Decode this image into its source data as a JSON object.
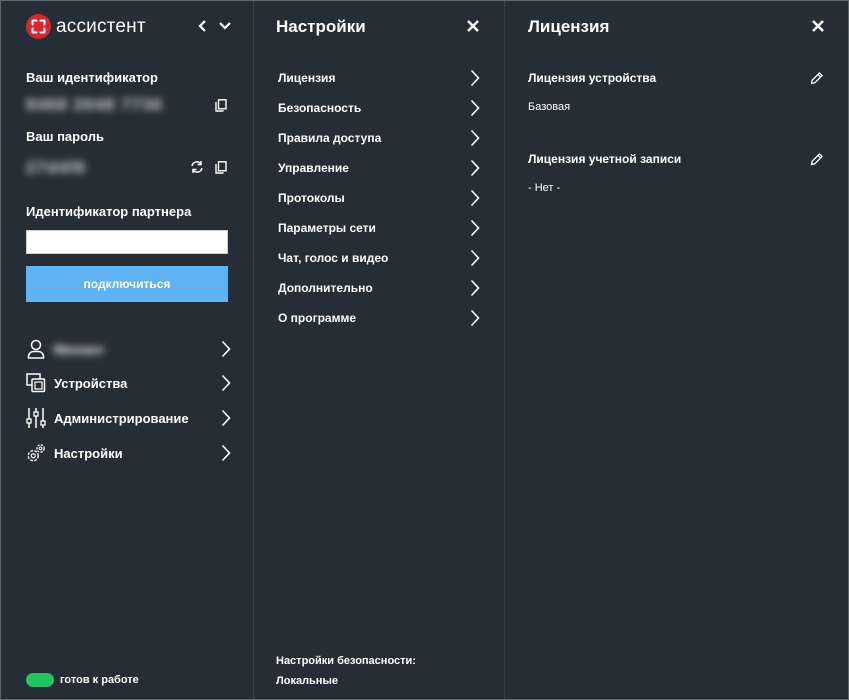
{
  "app": {
    "logo_text": "ассистент",
    "logo_color": "#d8262f"
  },
  "left": {
    "id_label": "Ваш идентификатор",
    "id_value": "8468 2648 7736",
    "password_label": "Ваш пароль",
    "password_value": "27d4f8",
    "partner_label": "Идентификатор партнера",
    "partner_value": "",
    "connect_label": "подключиться",
    "connect_color": "#5fb3f4",
    "nav": [
      {
        "label": "Михаил",
        "icon": "user-icon"
      },
      {
        "label": "Устройства",
        "icon": "devices-icon"
      },
      {
        "label": "Администрирование",
        "icon": "sliders-icon"
      },
      {
        "label": "Настройки",
        "icon": "gear-icon"
      }
    ],
    "status_text": "готов к работе",
    "status_color": "#22c55e"
  },
  "settings": {
    "title": "Настройки",
    "items": [
      "Лицензия",
      "Безопасность",
      "Правила доступа",
      "Управление",
      "Протоколы",
      "Параметры сети",
      "Чат, голос и видео",
      "Дополнительно",
      "О программе"
    ],
    "footer_label": "Настройки безопасности:",
    "footer_value": "Локальные"
  },
  "license": {
    "title": "Лицензия",
    "device_label": "Лицензия устройства",
    "device_value": "Базовая",
    "account_label": "Лицензия учетной записи",
    "account_value": "- Нет -"
  }
}
